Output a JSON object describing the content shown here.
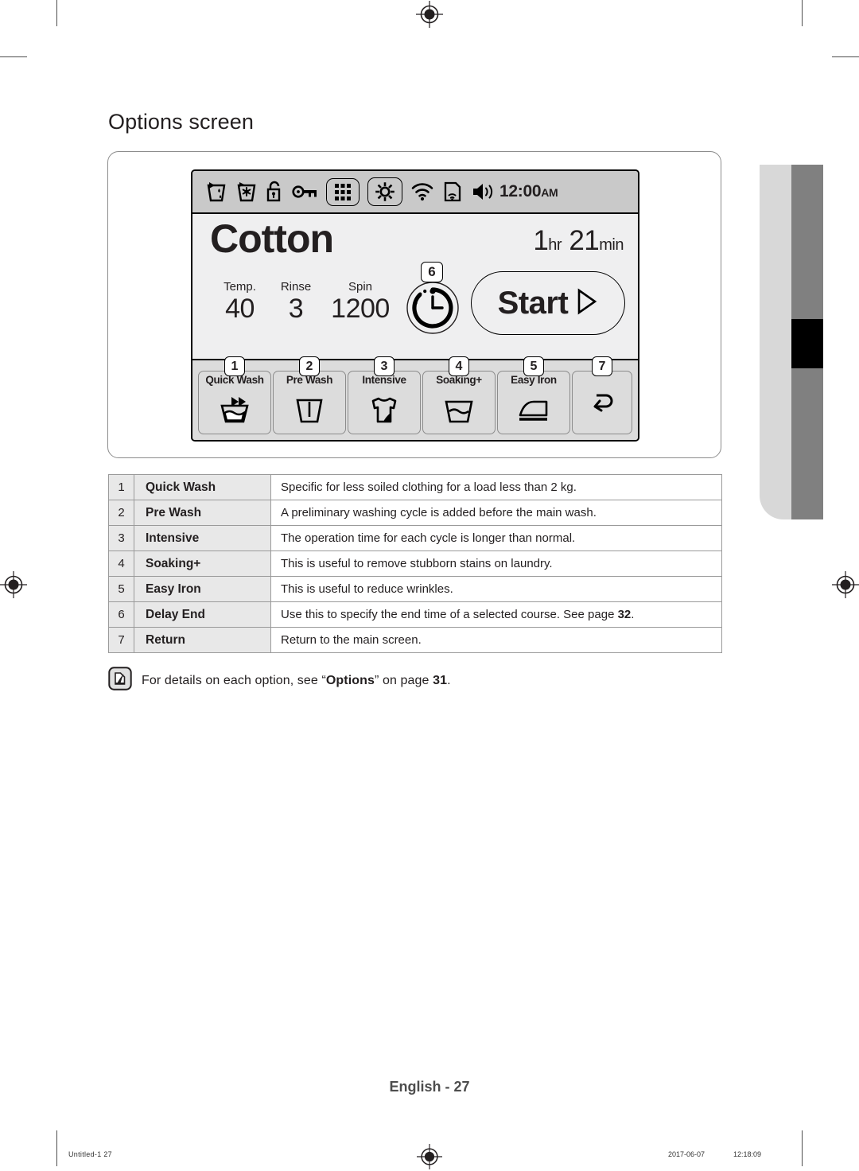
{
  "page": {
    "title": "Options screen",
    "footer": "English - 27"
  },
  "status_bar": {
    "icons": [
      {
        "name": "water-supply-icon",
        "label": "water supply"
      },
      {
        "name": "snowflake-tub-icon",
        "label": "freeze warning"
      },
      {
        "name": "unlock-icon",
        "label": "door unlocked"
      },
      {
        "name": "key-icon",
        "label": "child lock key"
      },
      {
        "name": "keypad-grid-icon",
        "label": "keypad",
        "boxed": true
      },
      {
        "name": "gear-icon",
        "label": "settings",
        "boxed": true
      },
      {
        "name": "wifi-icon",
        "label": "wi-fi"
      },
      {
        "name": "smart-control-icon",
        "label": "smart control"
      },
      {
        "name": "volume-icon",
        "label": "sound"
      }
    ],
    "time": "12:00",
    "time_ampm": "AM"
  },
  "display": {
    "course_name": "Cotton",
    "remaining": {
      "hours": "1",
      "hours_unit": "hr",
      "minutes": "21",
      "minutes_unit": "min"
    },
    "settings": [
      {
        "label": "Temp.",
        "value": "40"
      },
      {
        "label": "Rinse",
        "value": "3"
      },
      {
        "label": "Spin",
        "value": "1200"
      }
    ],
    "delay_end": {
      "callout": "6",
      "icon": "delay-end-clock-icon"
    },
    "start_button": {
      "label": "Start",
      "icon": "play-triangle-icon"
    }
  },
  "option_buttons": [
    {
      "callout": "1",
      "label": "Quick Wash",
      "icon": "quick-wash-basin-icon"
    },
    {
      "callout": "2",
      "label": "Pre Wash",
      "icon": "pre-wash-basin-icon"
    },
    {
      "callout": "3",
      "label": "Intensive",
      "icon": "intensive-shirt-icon"
    },
    {
      "callout": "4",
      "label": "Soaking+",
      "icon": "soaking-basin-icon"
    },
    {
      "callout": "5",
      "label": "Easy Iron",
      "icon": "iron-icon"
    },
    {
      "callout": "7",
      "label": "",
      "icon": "return-arrow-icon"
    }
  ],
  "options_table": {
    "rows": [
      {
        "num": "1",
        "name": "Quick Wash",
        "desc": "Specific for less soiled clothing for a load less than 2 kg.",
        "desc_bold_tail": ""
      },
      {
        "num": "2",
        "name": "Pre Wash",
        "desc": "A preliminary washing cycle is added before the main wash.",
        "desc_bold_tail": ""
      },
      {
        "num": "3",
        "name": "Intensive",
        "desc": "The operation time for each cycle is longer than normal.",
        "desc_bold_tail": ""
      },
      {
        "num": "4",
        "name": "Soaking+",
        "desc": "This is useful to remove stubborn stains on laundry.",
        "desc_bold_tail": ""
      },
      {
        "num": "5",
        "name": "Easy Iron",
        "desc": "This is useful to reduce wrinkles.",
        "desc_bold_tail": ""
      },
      {
        "num": "6",
        "name": "Delay End",
        "desc": "Use this to specify the end time of a selected course. See page ",
        "desc_bold_tail": "32",
        "desc_suffix": "."
      },
      {
        "num": "7",
        "name": "Return",
        "desc": "Return to the main screen.",
        "desc_bold_tail": ""
      }
    ]
  },
  "note": {
    "icon": "note-pencil-icon",
    "prefix": "For details on each option, see “",
    "bold": "Options",
    "middle": "” on page ",
    "bold2": "31",
    "suffix": "."
  },
  "print_strip": {
    "filename": "Untitled-1   27",
    "date": "2017-06-07",
    "time": "12:18:09"
  }
}
